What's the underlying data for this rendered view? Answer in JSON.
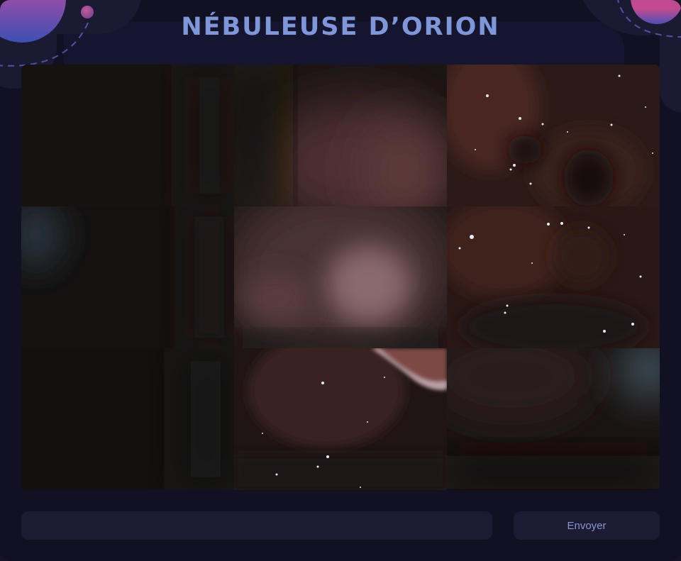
{
  "game": {
    "title": "NÉBULEUSE D’ORION"
  },
  "answer": {
    "value": "",
    "placeholder": ""
  },
  "controls": {
    "submit_label": "Envoyer"
  },
  "board": {
    "columns": 3,
    "rows": 3,
    "tiles": [
      {
        "row": 0,
        "col": 0,
        "state": "blurred"
      },
      {
        "row": 0,
        "col": 1,
        "state": "blurred"
      },
      {
        "row": 0,
        "col": 2,
        "state": "revealed"
      },
      {
        "row": 1,
        "col": 0,
        "state": "blurred"
      },
      {
        "row": 1,
        "col": 1,
        "state": "blurred"
      },
      {
        "row": 1,
        "col": 2,
        "state": "revealed"
      },
      {
        "row": 2,
        "col": 0,
        "state": "blurred"
      },
      {
        "row": 2,
        "col": 1,
        "state": "revealed"
      },
      {
        "row": 2,
        "col": 2,
        "state": "blurred"
      }
    ]
  },
  "colors": {
    "background": "#121124",
    "title": "#7f97d8",
    "accent_pink": "#c24b93",
    "accent_blue": "#3e4fb3",
    "control_bg": "#1d1b33",
    "button_text": "#8897cf"
  }
}
